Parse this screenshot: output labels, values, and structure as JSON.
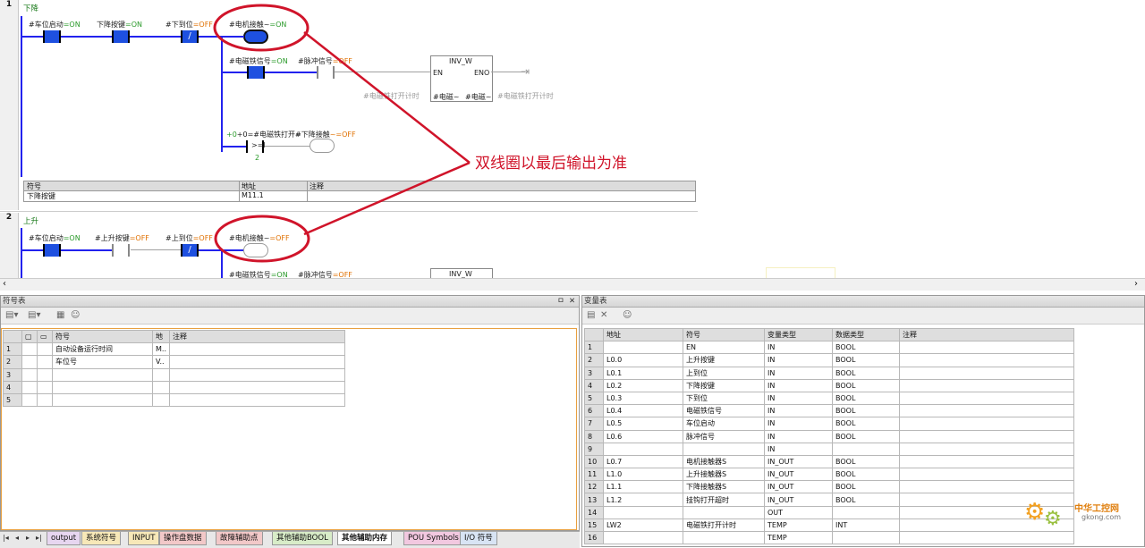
{
  "ladder": {
    "network1": {
      "number": "1",
      "title": "下降",
      "rung1": [
        {
          "label": "#车位启动",
          "state": "=ON"
        },
        {
          "label": "下降按键",
          "state": "=ON"
        },
        {
          "label": "#下到位",
          "state": "=OFF"
        }
      ],
      "coil": {
        "label": "#电机接触~",
        "state": "=ON"
      },
      "branch2": [
        {
          "label": "#电磁铁信号",
          "state": "=ON"
        },
        {
          "label": "#脉冲信号",
          "state": "=OFF"
        }
      ],
      "inv_box": {
        "title": "INV_W",
        "en": "EN",
        "eno": "ENO",
        "in_pre": "#电磁铁打开计时",
        "in_name": "#电磁~",
        "out_name": "#电磁~",
        "out_post": "#电磁铁打开计时"
      },
      "branch3": {
        "compare_label": "+0=#电磁铁打开~",
        "compare_op": ">=I",
        "compare_value": "2",
        "contact_label": "#下降接触",
        "contact_state": "~=OFF"
      },
      "symbol_table": {
        "headers": [
          "符号",
          "地址",
          "注释"
        ],
        "row": [
          "下降按键",
          "M11.1",
          ""
        ]
      }
    },
    "network2": {
      "number": "2",
      "title": "上升",
      "rung1": [
        {
          "label": "#车位启动",
          "state": "=ON"
        },
        {
          "label": "#上升按键",
          "state": "=OFF"
        },
        {
          "label": "#上到位",
          "state": "=OFF"
        }
      ],
      "coil": {
        "label": "#电机接触~",
        "state": "=OFF"
      },
      "branch2": [
        {
          "label": "#电磁铁信号",
          "state": "=ON"
        },
        {
          "label": "#脉冲信号",
          "state": "=OFF"
        }
      ],
      "inv_box_title": "INV_W"
    },
    "annotation": "双线圈以最后输出为准"
  },
  "symbol_panel": {
    "title": "符号表",
    "pin": "ㅁ",
    "close": "✕",
    "headers": [
      "",
      "",
      "",
      "符号",
      "地",
      "注释"
    ],
    "rows": [
      {
        "n": "1",
        "sym": "自动设备运行时间",
        "addr": "M..",
        "note": ""
      },
      {
        "n": "2",
        "sym": "车位号",
        "addr": "V..",
        "note": ""
      },
      {
        "n": "3",
        "sym": "",
        "addr": "",
        "note": ""
      },
      {
        "n": "4",
        "sym": "",
        "addr": "",
        "note": ""
      },
      {
        "n": "5",
        "sym": "",
        "addr": "",
        "note": ""
      }
    ]
  },
  "var_panel": {
    "title": "变量表",
    "headers": [
      "",
      "地址",
      "符号",
      "变量类型",
      "数据类型",
      "注释"
    ],
    "rows": [
      {
        "n": "1",
        "addr": "",
        "sym": "EN",
        "vtype": "IN",
        "dtype": "BOOL"
      },
      {
        "n": "2",
        "addr": "L0.0",
        "sym": "上升按键",
        "vtype": "IN",
        "dtype": "BOOL"
      },
      {
        "n": "3",
        "addr": "L0.1",
        "sym": "上到位",
        "vtype": "IN",
        "dtype": "BOOL"
      },
      {
        "n": "4",
        "addr": "L0.2",
        "sym": "下降按键",
        "vtype": "IN",
        "dtype": "BOOL"
      },
      {
        "n": "5",
        "addr": "L0.3",
        "sym": "下到位",
        "vtype": "IN",
        "dtype": "BOOL"
      },
      {
        "n": "6",
        "addr": "L0.4",
        "sym": "电磁铁信号",
        "vtype": "IN",
        "dtype": "BOOL"
      },
      {
        "n": "7",
        "addr": "L0.5",
        "sym": "车位启动",
        "vtype": "IN",
        "dtype": "BOOL"
      },
      {
        "n": "8",
        "addr": "L0.6",
        "sym": "脉冲信号",
        "vtype": "IN",
        "dtype": "BOOL"
      },
      {
        "n": "9",
        "addr": "",
        "sym": "",
        "vtype": "IN",
        "dtype": ""
      },
      {
        "n": "10",
        "addr": "L0.7",
        "sym": "电机接触器S",
        "vtype": "IN_OUT",
        "dtype": "BOOL"
      },
      {
        "n": "11",
        "addr": "L1.0",
        "sym": "上升接触器S",
        "vtype": "IN_OUT",
        "dtype": "BOOL"
      },
      {
        "n": "12",
        "addr": "L1.1",
        "sym": "下降接触器S",
        "vtype": "IN_OUT",
        "dtype": "BOOL"
      },
      {
        "n": "13",
        "addr": "L1.2",
        "sym": "挂钩打开超时",
        "vtype": "IN_OUT",
        "dtype": "BOOL"
      },
      {
        "n": "14",
        "addr": "",
        "sym": "",
        "vtype": "OUT",
        "dtype": ""
      },
      {
        "n": "15",
        "addr": "LW2",
        "sym": "电磁铁打开计时",
        "vtype": "TEMP",
        "dtype": "INT"
      },
      {
        "n": "16",
        "addr": "",
        "sym": "",
        "vtype": "TEMP",
        "dtype": ""
      }
    ]
  },
  "tabs": [
    "output",
    "系统符号",
    "INPUT",
    "操作盘数据",
    "故障辅助点",
    "其他辅助BOOL",
    "其他辅助内存",
    "POU Symbols",
    "I/O 符号"
  ],
  "active_tab": "其他辅助内存",
  "nav": [
    "|◂",
    "◂",
    "▸",
    "▸|"
  ],
  "watermark": {
    "main": "中华工控网",
    "sub": "gkong.com"
  },
  "colors": {
    "on": "#2a9a2a",
    "off": "#e07000",
    "contact": "#1e50e0",
    "annotation": "#d0142a"
  }
}
